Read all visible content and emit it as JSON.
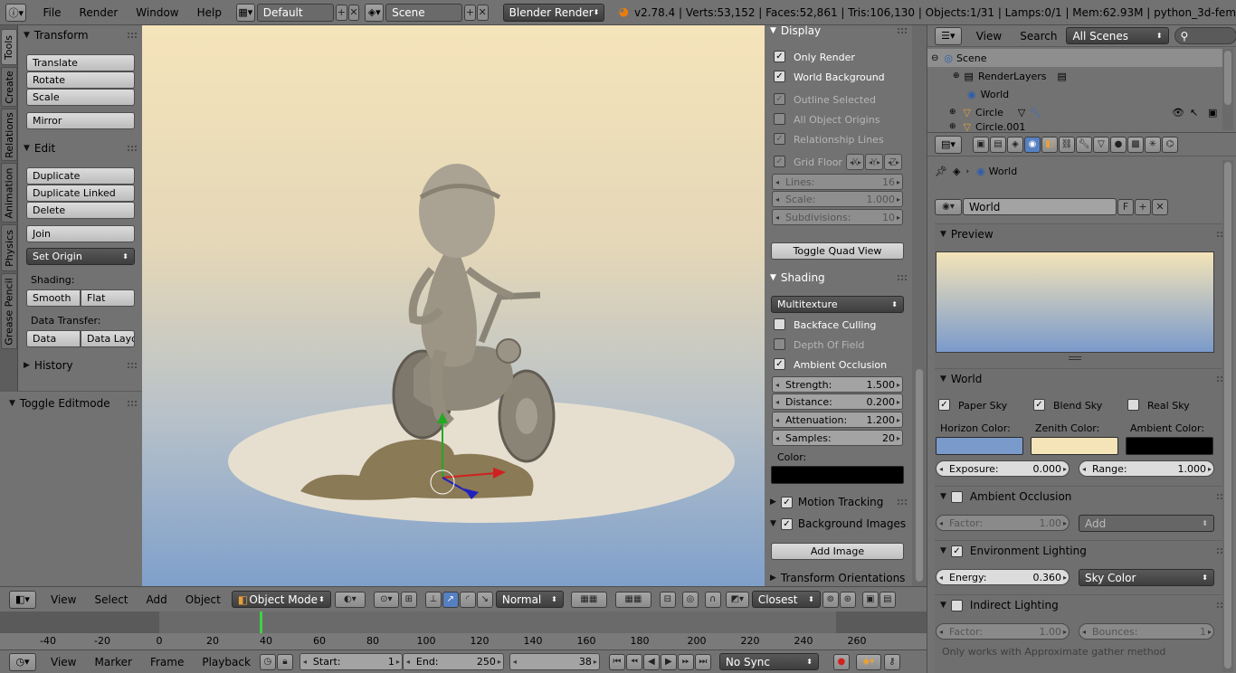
{
  "topbar": {
    "menus": [
      "File",
      "Render",
      "Window",
      "Help"
    ],
    "layout": "Default",
    "scene": "Scene",
    "engine": "Blender Render",
    "stats": "v2.78.4 | Verts:53,152 | Faces:52,861 | Tris:106,130 | Objects:1/31 | Lamps:0/1 | Mem:62.93M | python_3d-fem"
  },
  "tool_tabs": [
    "Tools",
    "Create",
    "Relations",
    "Animation",
    "Physics",
    "Grease Pencil"
  ],
  "tools": {
    "transform_title": "Transform",
    "transform_buttons": [
      "Translate",
      "Rotate",
      "Scale"
    ],
    "mirror": "Mirror",
    "edit_title": "Edit",
    "edit_buttons": [
      "Duplicate",
      "Duplicate Linked",
      "Delete"
    ],
    "join": "Join",
    "set_origin": "Set Origin",
    "shading_label": "Shading:",
    "smooth": "Smooth",
    "flat": "Flat",
    "data_transfer_label": "Data Transfer:",
    "data": "Data",
    "data_layout": "Data Layo",
    "history": "History"
  },
  "operator": {
    "title": "Toggle Editmode"
  },
  "npanel": {
    "display_title": "Display",
    "only_render": "Only Render",
    "world_background": "World Background",
    "outline_selected": "Outline Selected",
    "all_object_origins": "All Object Origins",
    "relationship_lines": "Relationship Lines",
    "grid_floor": "Grid Floor",
    "axes": [
      "X",
      "Y",
      "Z"
    ],
    "lines_label": "Lines:",
    "lines_value": "16",
    "scale_label": "Scale:",
    "scale_value": "1.000",
    "subdivisions_label": "Subdivisions:",
    "subdivisions_value": "10",
    "toggle_quad_view": "Toggle Quad View",
    "shading_title": "Shading",
    "shading_mode": "Multitexture",
    "backface_culling": "Backface Culling",
    "depth_of_field": "Depth Of Field",
    "ambient_occlusion": "Ambient Occlusion",
    "strength_label": "Strength:",
    "strength_value": "1.500",
    "distance_label": "Distance:",
    "distance_value": "0.200",
    "attenuation_label": "Attenuation:",
    "attenuation_value": "1.200",
    "samples_label": "Samples:",
    "samples_value": "20",
    "color_label": "Color:",
    "motion_tracking": "Motion Tracking",
    "background_images": "Background Images",
    "add_image": "Add Image",
    "transform_orientations": "Transform Orientations"
  },
  "view_header": {
    "menus": [
      "View",
      "Select",
      "Add",
      "Object"
    ],
    "mode": "Object Mode",
    "pivot": "Normal",
    "snap": "Closest"
  },
  "timeline": {
    "ticks": [
      "-40",
      "-20",
      "0",
      "20",
      "40",
      "60",
      "80",
      "100",
      "120",
      "140",
      "160",
      "180",
      "200",
      "220",
      "240",
      "260"
    ],
    "current_frame_marker": 38
  },
  "timeline_header": {
    "menus": [
      "View",
      "Marker",
      "Frame",
      "Playback"
    ],
    "start_label": "Start:",
    "start_value": "1",
    "end_label": "End:",
    "end_value": "250",
    "current": "38",
    "sync": "No Sync"
  },
  "outliner": {
    "menus": [
      "View",
      "Search"
    ],
    "filter": "All Scenes",
    "rows": [
      "Scene",
      "RenderLayers",
      "World",
      "Circle",
      "Circle.001"
    ]
  },
  "properties": {
    "breadcrumb": "World",
    "world_name": "World",
    "fake_user": "F",
    "preview_title": "Preview",
    "world_title": "World",
    "paper_sky": "Paper Sky",
    "blend_sky": "Blend Sky",
    "real_sky": "Real Sky",
    "horizon_color_label": "Horizon Color:",
    "zenith_color_label": "Zenith Color:",
    "ambient_color_label": "Ambient Color:",
    "horizon_color": "#7a9acb",
    "zenith_color": "#f4e4b8",
    "ambient_color": "#000000",
    "exposure_label": "Exposure:",
    "exposure_value": "0.000",
    "range_label": "Range:",
    "range_value": "1.000",
    "ao_title": "Ambient Occlusion",
    "ao_factor_label": "Factor:",
    "ao_factor_value": "1.00",
    "ao_blend": "Add",
    "env_title": "Environment Lighting",
    "energy_label": "Energy:",
    "energy_value": "0.360",
    "env_color": "Sky Color",
    "indirect_title": "Indirect Lighting",
    "ind_factor_label": "Factor:",
    "ind_factor_value": "1.00",
    "bounces_label": "Bounces:",
    "bounces_value": "1",
    "note": "Only works with Approximate gather method"
  }
}
